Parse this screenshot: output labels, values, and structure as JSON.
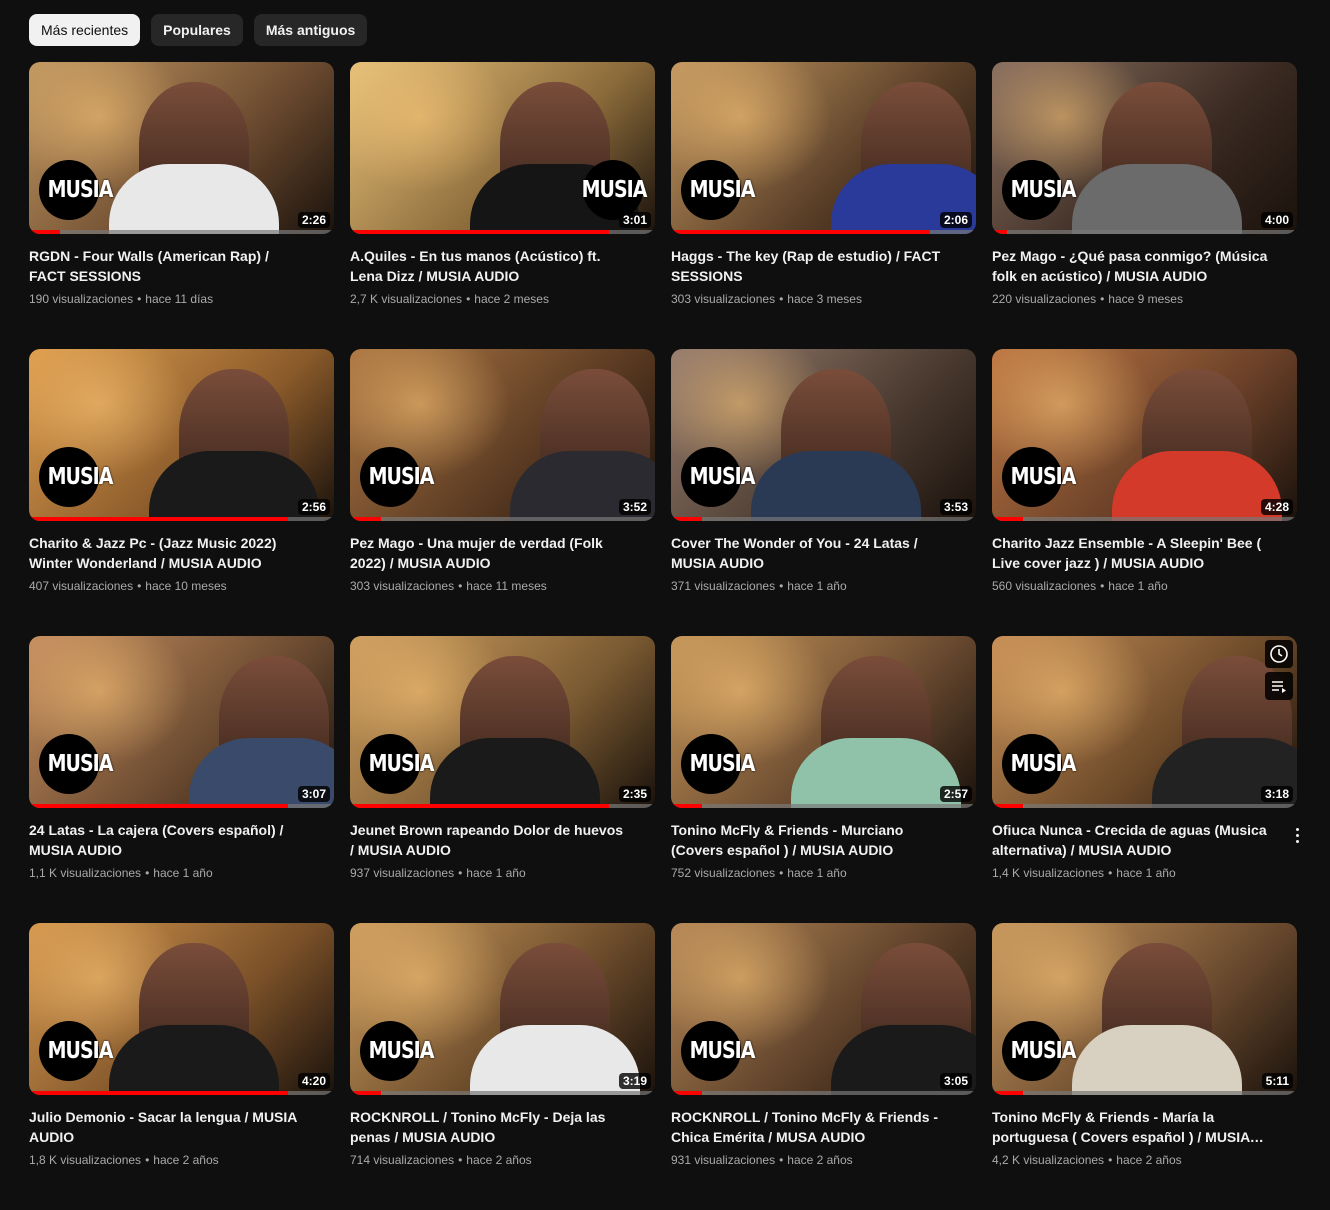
{
  "filters": [
    {
      "label": "Más recientes",
      "active": true
    },
    {
      "label": "Populares",
      "active": false
    },
    {
      "label": "Más antiguos",
      "active": false
    }
  ],
  "logo_text": "MUSIA",
  "videos": [
    {
      "title": "RGDN - Four Walls (American Rap) / FACT SESSIONS",
      "views": "190 visualizaciones",
      "age": "hace 11 días",
      "duration": "2:26",
      "watched": 0.1,
      "palette": [
        "#6b4a2f",
        "#c49a63"
      ],
      "shirt": "#e8e8e8",
      "logo": "left"
    },
    {
      "title": "A.Quiles - En tus manos (Acústico) ft. Lena Dizz / MUSIA AUDIO",
      "views": "2,7 K visualizaciones",
      "age": "hace 2 meses",
      "duration": "3:01",
      "watched": 0.85,
      "palette": [
        "#8a6a3a",
        "#e8c27a"
      ],
      "shirt": "#151515",
      "logo": "right"
    },
    {
      "title": "Haggs - The key (Rap de estudio) / FACT SESSIONS",
      "views": "303 visualizaciones",
      "age": "hace 3 meses",
      "duration": "2:06",
      "watched": 0.85,
      "palette": [
        "#5a3f28",
        "#c79b62"
      ],
      "shirt": "#2a3a9a",
      "logo": "left"
    },
    {
      "title": "Pez Mago - ¿Qué pasa conmigo? (Música folk en acústico) / MUSIA AUDIO",
      "views": "220 visualizaciones",
      "age": "hace 9 meses",
      "duration": "4:00",
      "watched": 0.05,
      "palette": [
        "#3a2a22",
        "#8a7060"
      ],
      "shirt": "#6b6b6b",
      "logo": "left"
    },
    {
      "title": "Charito & Jazz Pc - (Jazz Music 2022) Winter Wonderland / MUSIA AUDIO",
      "views": "407 visualizaciones",
      "age": "hace 10 meses",
      "duration": "2:56",
      "watched": 0.85,
      "palette": [
        "#8a5a2a",
        "#e0a050"
      ],
      "shirt": "#1a1a1a",
      "logo": "left"
    },
    {
      "title": "Pez Mago - Una mujer de verdad (Folk 2022) / MUSIA AUDIO",
      "views": "303 visualizaciones",
      "age": "hace 11 meses",
      "duration": "3:52",
      "watched": 0.1,
      "palette": [
        "#5a3a22",
        "#b07a45"
      ],
      "shirt": "#2a2a30",
      "logo": "left"
    },
    {
      "title": "Cover The Wonder of You - 24 Latas / MUSIA AUDIO",
      "views": "371 visualizaciones",
      "age": "hace 1 año",
      "duration": "3:53",
      "watched": 0.1,
      "palette": [
        "#4a3a30",
        "#9a8070"
      ],
      "shirt": "#2a3a55",
      "logo": "left"
    },
    {
      "title": "Charito Jazz Ensemble - A Sleepin' Bee ( Live cover jazz ) / MUSIA AUDIO",
      "views": "560 visualizaciones",
      "age": "hace 1 año",
      "duration": "4:28",
      "watched": 0.1,
      "palette": [
        "#6a4028",
        "#c07a45"
      ],
      "shirt": "#d43a2a",
      "logo": "left"
    },
    {
      "title": "24 Latas - La cajera (Covers español) / MUSIA AUDIO",
      "views": "1,1 K visualizaciones",
      "age": "hace 1 año",
      "duration": "3:07",
      "watched": 0.85,
      "palette": [
        "#6a4a30",
        "#c89060"
      ],
      "shirt": "#3a4a6a",
      "logo": "left"
    },
    {
      "title": "Jeunet Brown rapeando Dolor de huevos / MUSIA AUDIO",
      "views": "937 visualizaciones",
      "age": "hace 1 año",
      "duration": "2:35",
      "watched": 0.85,
      "palette": [
        "#7a5a32",
        "#d0a060"
      ],
      "shirt": "#1a1a1a",
      "logo": "left"
    },
    {
      "title": "Tonino McFly & Friends - Murciano (Covers español ) / MUSIA AUDIO",
      "views": "752 visualizaciones",
      "age": "hace 1 año",
      "duration": "2:57",
      "watched": 0.1,
      "palette": [
        "#6a4a30",
        "#c8985a"
      ],
      "shirt": "#8fc2a8",
      "logo": "left"
    },
    {
      "title": "Ofiuca Nunca - Crecida de aguas (Musica alternativa) / MUSIA AUDIO",
      "views": "1,4 K visualizaciones",
      "age": "hace 1 año",
      "duration": "3:18",
      "watched": 0.1,
      "palette": [
        "#6a4828",
        "#c89058"
      ],
      "shirt": "#222222",
      "logo": "left",
      "hovered": true
    },
    {
      "title": "Julio Demonio - Sacar la lengua / MUSIA AUDIO",
      "views": "1,8 K visualizaciones",
      "age": "hace 2 años",
      "duration": "4:20",
      "watched": 0.85,
      "palette": [
        "#7a5028",
        "#d89a50"
      ],
      "shirt": "#1a1a1a",
      "logo": "left"
    },
    {
      "title": "ROCKNROLL / Tonino McFly - Deja las penas / MUSIA AUDIO",
      "views": "714 visualizaciones",
      "age": "hace 2 años",
      "duration": "3:19",
      "watched": 0.1,
      "palette": [
        "#6a4a2a",
        "#d0a060"
      ],
      "shirt": "#e8e8e8",
      "logo": "left"
    },
    {
      "title": "ROCKNROLL / Tonino McFly & Friends - Chica Emérita / MUSA AUDIO",
      "views": "931 visualizaciones",
      "age": "hace 2 años",
      "duration": "3:05",
      "watched": 0.1,
      "palette": [
        "#5a3e28",
        "#b88a58"
      ],
      "shirt": "#1a1a1a",
      "logo": "left"
    },
    {
      "title": "Tonino McFly & Friends - María la portuguesa ( Covers español ) / MUSIA AUDIO",
      "views": "4,2 K visualizaciones",
      "age": "hace 2 años",
      "duration": "5:11",
      "watched": 0.1,
      "palette": [
        "#6a4a2e",
        "#c8985e"
      ],
      "shirt": "#d8d0c0",
      "logo": "left"
    }
  ],
  "hover_controls": [
    "watch-later-icon",
    "add-to-queue-icon"
  ]
}
